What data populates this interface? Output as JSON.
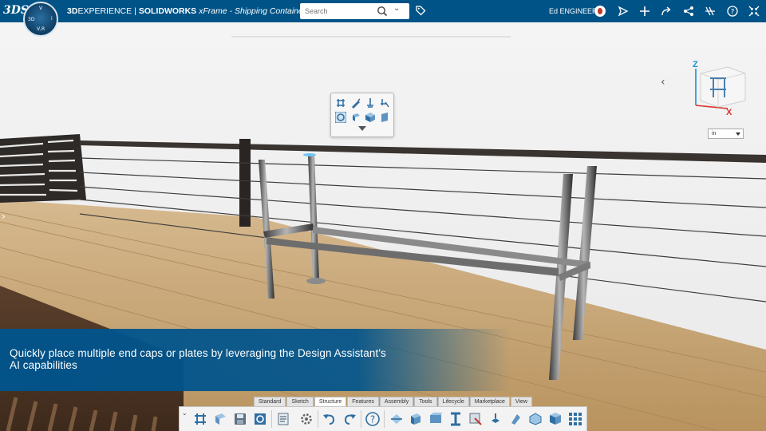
{
  "header": {
    "brand_prefix": "3D",
    "brand_experience": "EXPERIENCE",
    "separator": "|",
    "app_name": "SOLIDWORKS",
    "document_name": "xFrame - Shipping Container",
    "compass_labels": {
      "top": "V",
      "left": "3D",
      "right": "i",
      "bottom": "V,R"
    },
    "logo_text": "3DS",
    "search": {
      "placeholder": "Search",
      "value": ""
    },
    "user": "Ed ENGINEER",
    "icons": [
      "tag-icon",
      "user-avatar",
      "share-icon",
      "add-icon",
      "forward-icon",
      "network-share-icon",
      "tools-icon",
      "help-icon",
      "collapse-icon"
    ]
  },
  "viewport": {
    "units_value": "in",
    "cube_axes": {
      "z": "Z",
      "x": "X"
    }
  },
  "context_toolbar": {
    "icons": [
      "structure-system-icon",
      "sketch-pencil-icon",
      "end-cap-icon",
      "add-plate-icon",
      "design-assistant-icon",
      "profile-icon",
      "cube-icon",
      "plate-icon"
    ],
    "more_icon": "chevron-down-icon"
  },
  "caption": {
    "text": "Quickly place multiple end caps or plates by leveraging the Design Assistant's AI capabilities"
  },
  "action_bar": {
    "tabs": [
      "Standard",
      "Sketch",
      "Structure",
      "Features",
      "Assembly",
      "Tools",
      "Lifecycle",
      "Marketplace",
      "View"
    ],
    "active_tab": "Structure",
    "icons": [
      "structure-system-icon",
      "member-icon",
      "save-icon",
      "rebuild-icon",
      "properties-icon",
      "options-gear-icon",
      "undo-icon",
      "redo-icon",
      "help-icon",
      "corner-treatment-icon",
      "end-cap-icon",
      "gusset-icon",
      "weldment-profile-icon",
      "trim-extend-icon",
      "cut-list-icon",
      "connection-icon",
      "plate-icon",
      "pattern-icon",
      "grid-icon"
    ]
  },
  "colors": {
    "header_bg": "#005386",
    "caption_bg": "#00548c",
    "deck_wood": "#c9a678",
    "accent": "#1e8fd6"
  }
}
